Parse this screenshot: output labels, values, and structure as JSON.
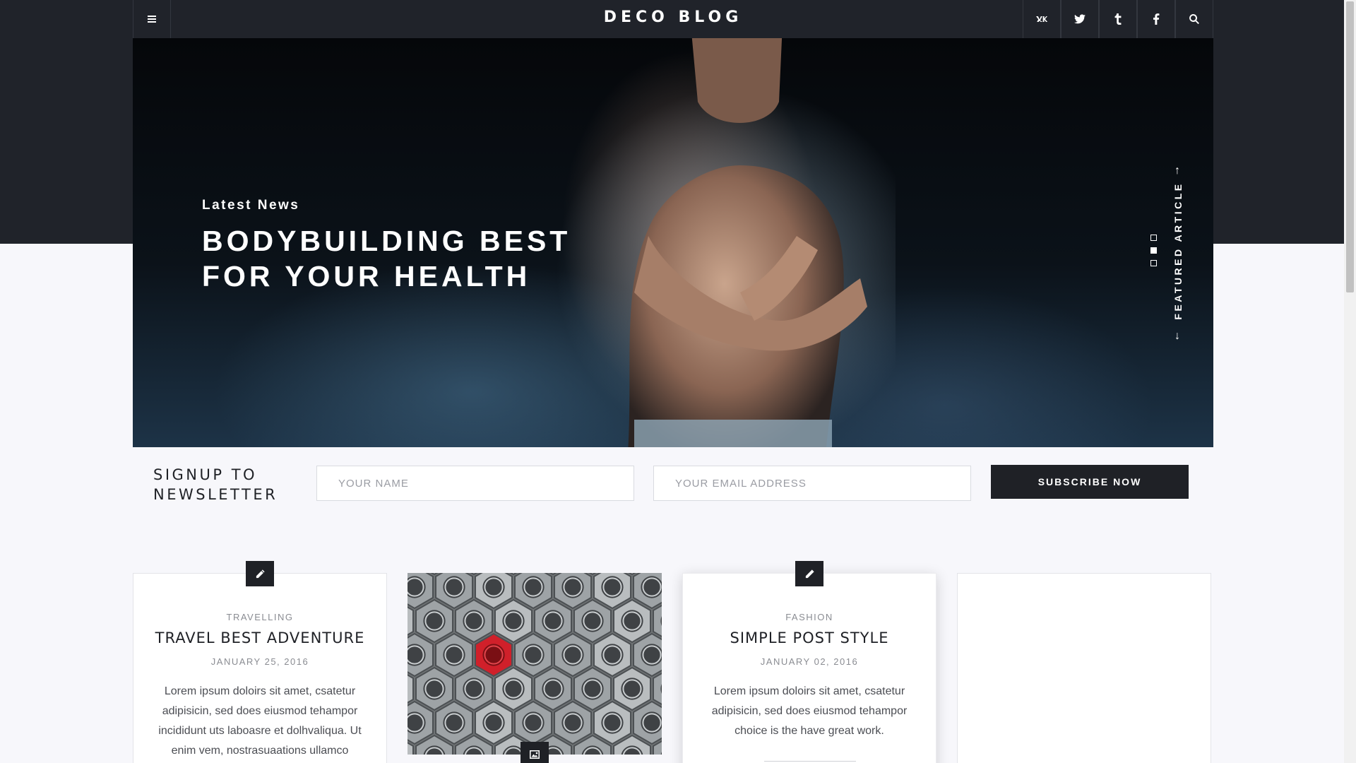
{
  "header": {
    "logo": "DECO BLOG",
    "menu_icon": "hamburger-menu-icon",
    "social": [
      {
        "name": "vk",
        "icon": "vk-icon"
      },
      {
        "name": "twitter",
        "icon": "twitter-icon"
      },
      {
        "name": "tumblr",
        "icon": "tumblr-icon"
      },
      {
        "name": "facebook",
        "icon": "facebook-icon"
      }
    ],
    "search_icon": "search-icon"
  },
  "hero": {
    "kicker": "Latest News",
    "title_line1": "BODYBUILDING BEST",
    "title_line2": "FOR YOUR HEALTH",
    "side_label": "FEATURED ARTICLE",
    "arrow_up": "↑",
    "arrow_down": "↓",
    "slides": 3,
    "active_slide": 2
  },
  "newsletter": {
    "title_line1": "SIGNUP TO",
    "title_line2": "NEWSLETTER",
    "name_placeholder": "YOUR NAME",
    "email_placeholder": "YOUR EMAIL ADDRESS",
    "button": "SUBSCRIBE NOW"
  },
  "posts": [
    {
      "category": "TRAVELLING",
      "title": "TRAVEL BEST ADVENTURE",
      "date": "JANUARY 25, 2016",
      "excerpt": "Lorem ipsum doloirs sit amet, csatetur adipisicin, sed does eiusmod tehampor incididunt uts laboasre et dolhvaliqua. Ut enim vem, nostrasuaations ullamco",
      "icon": "pencil-icon"
    },
    {
      "type": "image",
      "icon": "image-icon"
    },
    {
      "category": "FASHION",
      "title": "SIMPLE POST STYLE",
      "date": "JANUARY 02, 2016",
      "excerpt": "Lorem ipsum doloirs sit amet, csatetur adipisicin, sed does eiusmod tehampor choice is the have great work.",
      "icon": "pencil-icon"
    },
    {
      "type": "empty"
    }
  ],
  "colors": {
    "dark": "#20232a",
    "button": "#1f2126",
    "page_bg": "#f7f7fb",
    "red_nut": "#d0202a"
  }
}
